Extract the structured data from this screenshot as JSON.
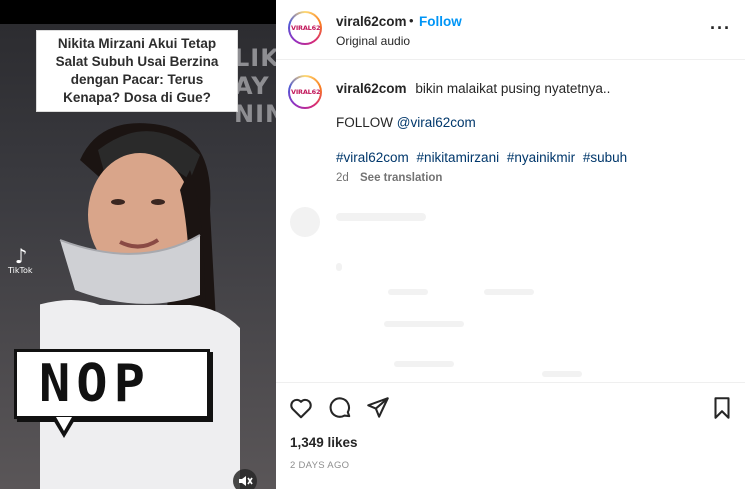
{
  "media": {
    "caption_overlay": "Nikita Mirzani Akui Tetap Salat Subuh Usai Berzina dengan Pacar: Terus Kenapa? Dosa di Gue?",
    "background_text": "LIK AY NIN",
    "sticker_text": "NOP",
    "watermark": "TikTok",
    "icons": {
      "watermark": "tiktok-icon",
      "mute": "muted-speaker-icon"
    }
  },
  "header": {
    "username": "viral62com",
    "separator": "•",
    "follow_label": "Follow",
    "audio_label": "Original audio",
    "avatar_text": "VIRAL62",
    "more_icon": "more-options-icon"
  },
  "post": {
    "username": "viral62com",
    "caption": "bikin malaikat pusing nyatetnya..",
    "follow_prefix": "FOLLOW ",
    "follow_mention": "@viral62com",
    "hashtags": [
      "#viral62com",
      "#nikitamirzani",
      "#nyainikmir",
      "#subuh"
    ],
    "time_ago": "2d",
    "see_translation": "See translation"
  },
  "actions": {
    "like_icon": "heart-icon",
    "comment_icon": "comment-icon",
    "share_icon": "share-icon",
    "save_icon": "bookmark-icon",
    "likes": "1,349 likes",
    "date": "2 DAYS AGO"
  },
  "colors": {
    "accent": "#0095f6",
    "link": "#00376b",
    "muted": "#737373",
    "avatar_ring": "#d62976"
  }
}
